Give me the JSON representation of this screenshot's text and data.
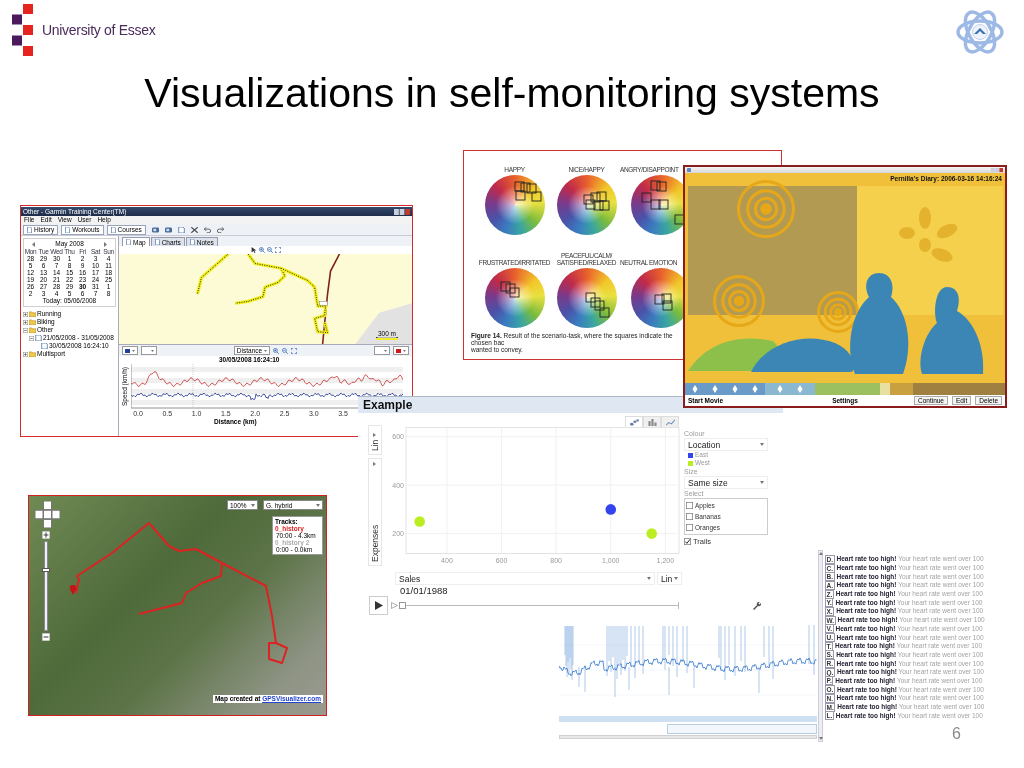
{
  "header": {
    "university": "University of Essex"
  },
  "title": "Visualizations in self-monitoring systems",
  "garmin_window": {
    "title": "Other - Garmin Training Center(TM)",
    "menu": [
      "File",
      "Edit",
      "View",
      "User",
      "Help"
    ],
    "toolbar": [
      "History",
      "Workouts",
      "Courses"
    ],
    "calendar": {
      "month": "May 2008",
      "weekdays": [
        "Mon",
        "Tue",
        "Wed",
        "Thu",
        "Fri",
        "Sat",
        "Sun"
      ],
      "days": [
        {
          "label": "28",
          "selected": false
        },
        {
          "label": "29",
          "selected": false
        },
        {
          "label": "30",
          "selected": false
        },
        {
          "label": "1",
          "selected": false
        },
        {
          "label": "2",
          "selected": false
        },
        {
          "label": "3",
          "selected": false
        },
        {
          "label": "4",
          "selected": false
        },
        {
          "label": "5",
          "selected": false
        },
        {
          "label": "6",
          "selected": false
        },
        {
          "label": "7",
          "selected": false
        },
        {
          "label": "8",
          "selected": false
        },
        {
          "label": "9",
          "selected": false
        },
        {
          "label": "10",
          "selected": false
        },
        {
          "label": "11",
          "selected": false
        },
        {
          "label": "12",
          "selected": false
        },
        {
          "label": "13",
          "selected": false
        },
        {
          "label": "14",
          "selected": false
        },
        {
          "label": "15",
          "selected": false
        },
        {
          "label": "16",
          "selected": false
        },
        {
          "label": "17",
          "selected": false
        },
        {
          "label": "18",
          "selected": false
        },
        {
          "label": "19",
          "selected": false
        },
        {
          "label": "20",
          "selected": false
        },
        {
          "label": "21",
          "selected": false
        },
        {
          "label": "22",
          "selected": false
        },
        {
          "label": "23",
          "selected": false
        },
        {
          "label": "24",
          "selected": false
        },
        {
          "label": "25",
          "selected": false
        },
        {
          "label": "26",
          "selected": false
        },
        {
          "label": "27",
          "selected": false
        },
        {
          "label": "28",
          "selected": false
        },
        {
          "label": "29",
          "selected": false
        },
        {
          "label": "30",
          "selected": true
        },
        {
          "label": "31",
          "selected": false
        },
        {
          "label": "1",
          "selected": false
        },
        {
          "label": "2",
          "selected": false
        },
        {
          "label": "3",
          "selected": false
        },
        {
          "label": "4",
          "selected": false
        },
        {
          "label": "5",
          "selected": false
        },
        {
          "label": "6",
          "selected": false
        },
        {
          "label": "7",
          "selected": false
        },
        {
          "label": "8",
          "selected": false
        }
      ],
      "today": "Today: 05/06/2008"
    },
    "tree": [
      {
        "label": "Running",
        "expanded": false
      },
      {
        "label": "Biking",
        "expanded": false
      },
      {
        "label": "Other",
        "expanded": true,
        "children": [
          {
            "label": "21/05/2008 - 31/05/2008",
            "expanded": true,
            "children": [
              {
                "label": "30/05/2008 16:24:10"
              }
            ]
          }
        ]
      },
      {
        "label": "Multisport",
        "expanded": false
      }
    ],
    "tabs": [
      {
        "label": "Map",
        "selected": true
      },
      {
        "label": "Charts",
        "selected": false
      },
      {
        "label": "Notes",
        "selected": false
      }
    ],
    "map": {
      "scale": "300 m"
    },
    "chart": {
      "dropdown": "Distance",
      "title": "30/05/2008 16:24:10",
      "ylabel": "Speed (km/h)",
      "xticks": [
        "0.0",
        "0.5",
        "1.0",
        "1.5",
        "2.0",
        "2.5",
        "3.0",
        "3.5"
      ],
      "xlabel": "Distance (km)"
    }
  },
  "emotion_figure": {
    "wheels": [
      {
        "label": "HAPPY"
      },
      {
        "label": "NICE/HAPPY"
      },
      {
        "label": "ANGRY/DISAPPOINT"
      },
      {
        "label": "FRUSTRATED/IRRITATED"
      },
      {
        "label": "PEACEFUL/CALM/\nSATISFIED/RELAXED"
      },
      {
        "label": "NEUTRAL EMOTION"
      }
    ],
    "caption": [
      "**Figure 14.** Result of the scenario-task, where the squares indicate the chosen bac",
      "wanted to convey."
    ]
  },
  "diary_window": {
    "title": "Pernilla's Diary: 2006-03-16 14:16:24",
    "start_button": "Start Movie",
    "settings_button": "Settings",
    "buttons": [
      "Continue",
      "Edit",
      "Delete"
    ]
  },
  "motion_chart": {
    "title": "Example",
    "view_tabs": [
      {
        "kind": "bubble",
        "selected": true
      },
      {
        "kind": "bar",
        "selected": false
      },
      {
        "kind": "line",
        "selected": false
      }
    ],
    "y_scale": "Lin",
    "chart_data": {
      "type": "scatter",
      "xlabel": "Sales",
      "ylabel": "Expenses",
      "x": [
        300,
        1000,
        1150
      ],
      "series": [
        {
          "name": "East",
          "color": "#3344ee",
          "values": [
            null,
            300,
            null
          ]
        },
        {
          "name": "West",
          "color": "#bbee22",
          "values": [
            250,
            null,
            200
          ]
        }
      ],
      "xlim": [
        250,
        1250
      ],
      "ylim": [
        120,
        640
      ],
      "xticks": [
        400,
        600,
        800,
        {
          "value": 1000,
          "label": "1,000"
        },
        {
          "value": 1200,
          "label": "1,200"
        }
      ],
      "yticks": [
        200,
        400,
        600
      ],
      "grid": true
    },
    "colour": {
      "label": "Colour",
      "value": "Location"
    },
    "size": {
      "label": "Size",
      "value": "Same size"
    },
    "select": {
      "label": "Select",
      "items": [
        {
          "label": "Apples",
          "checked": false
        },
        {
          "label": "Bananas",
          "checked": false
        },
        {
          "label": "Oranges",
          "checked": false
        }
      ]
    },
    "trails": {
      "label": "Trails",
      "checked": true
    },
    "x_scale": "Lin",
    "date": "01/01/1988",
    "time_slider": {
      "level": 0
    }
  },
  "map_panel": {
    "zoom_level": "100%",
    "map_type": "G. hybrid",
    "zoom_slider": {
      "level": 0.7
    },
    "tracks": {
      "title": "Tracks:",
      "items": [
        {
          "name": "0_history",
          "detail": "70:00 - 4.3km",
          "color": "#dd2222"
        },
        {
          "name": "0_history 2",
          "detail": "0:00 - 0.0km",
          "color": "#aaaaaa"
        }
      ]
    },
    "credit": "Map created at",
    "credit_link": "GPSVisualizer.com"
  },
  "heart_panel": {
    "alerts": [
      {
        "marker": "D.",
        "message": "**Heart rate too high!** Your heart rate went over 100"
      },
      {
        "marker": "C.",
        "message": "**Heart rate too high!** Your heart rate went over 100"
      },
      {
        "marker": "B.",
        "message": "**Heart rate too high!** Your heart rate went over 100"
      },
      {
        "marker": "A.",
        "message": "**Heart rate too high!** Your heart rate went over 100"
      },
      {
        "marker": "Z.",
        "message": "**Heart rate too high!** Your heart rate went over 100"
      },
      {
        "marker": "Y.",
        "message": "**Heart rate too high!** Your heart rate went over 100"
      },
      {
        "marker": "X.",
        "message": "**Heart rate too high!** Your heart rate went over 100"
      },
      {
        "marker": "W.",
        "message": "**Heart rate too high!** Your heart rate went over 100"
      },
      {
        "marker": "V.",
        "message": "**Heart rate too high!** Your heart rate went over 100"
      },
      {
        "marker": "U.",
        "message": "**Heart rate too high!** Your heart rate went over 100"
      },
      {
        "marker": "T.",
        "message": "**Heart rate too high!** Your heart rate went over 100"
      },
      {
        "marker": "S.",
        "message": "**Heart rate too high!** Your heart rate went over 100"
      },
      {
        "marker": "R.",
        "message": "**Heart rate too high!** Your heart rate went over 100"
      },
      {
        "marker": "Q.",
        "message": "**Heart rate too high!** Your heart rate went over 100"
      },
      {
        "marker": "P.",
        "message": "**Heart rate too high!** Your heart rate went over 100"
      },
      {
        "marker": "O.",
        "message": "**Heart rate too high!** Your heart rate went over 100"
      },
      {
        "marker": "N.",
        "message": "**Heart rate too high!** Your heart rate went over 100"
      },
      {
        "marker": "M.",
        "message": "**Heart rate too high!** Your heart rate went over 100"
      },
      {
        "marker": "L.",
        "message": "**Heart rate too high!** Your heart rate went over 100"
      }
    ]
  },
  "page_number": "6"
}
